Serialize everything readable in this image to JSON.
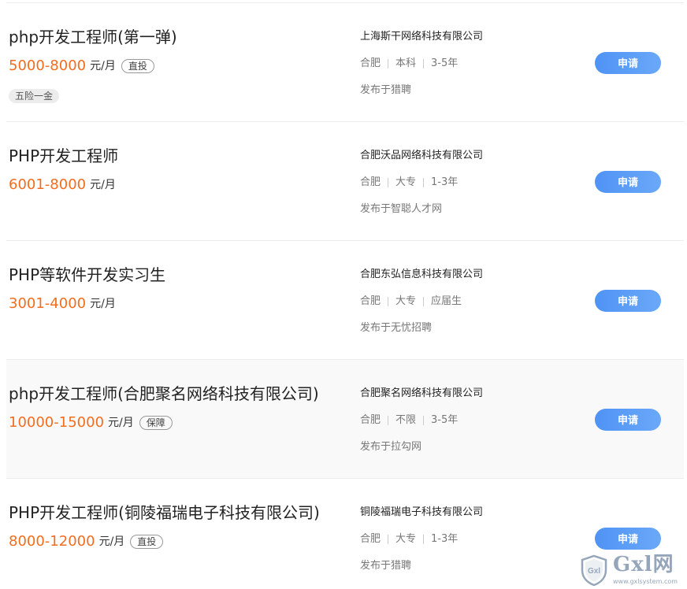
{
  "jobs": [
    {
      "title": "php开发工程师(第一弹)",
      "salary": "5000-8000",
      "salary_unit": "元/月",
      "badge": "直投",
      "welfare": [
        "五险一金"
      ],
      "company": "上海斯干网络科技有限公司",
      "location": "合肥",
      "education": "本科",
      "experience": "3-5年",
      "source": "发布于猎聘",
      "apply_label": "申请",
      "highlight": false
    },
    {
      "title": "PHP开发工程师",
      "salary": "6001-8000",
      "salary_unit": "元/月",
      "badge": "",
      "welfare": [],
      "company": "合肥沃品网络科技有限公司",
      "location": "合肥",
      "education": "大专",
      "experience": "1-3年",
      "source": "发布于智聪人才网",
      "apply_label": "申请",
      "highlight": false
    },
    {
      "title": "PHP等软件开发实习生",
      "salary": "3001-4000",
      "salary_unit": "元/月",
      "badge": "",
      "welfare": [],
      "company": "合肥东弘信息科技有限公司",
      "location": "合肥",
      "education": "大专",
      "experience": "应届生",
      "source": "发布于无忧招聘",
      "apply_label": "申请",
      "highlight": false
    },
    {
      "title": "php开发工程师(合肥聚名网络科技有限公司)",
      "salary": "10000-15000",
      "salary_unit": "元/月",
      "badge": "保障",
      "welfare": [],
      "company": "合肥聚名网络科技有限公司",
      "location": "合肥",
      "education": "不限",
      "experience": "3-5年",
      "source": "发布于拉勾网",
      "apply_label": "申请",
      "highlight": true
    },
    {
      "title": "PHP开发工程师(铜陵福瑞电子科技有限公司)",
      "salary": "8000-12000",
      "salary_unit": "元/月",
      "badge": "直投",
      "welfare": [],
      "company": "铜陵福瑞电子科技有限公司",
      "location": "合肥",
      "education": "大专",
      "experience": "1-3年",
      "source": "发布于猎聘",
      "apply_label": "申请",
      "highlight": false
    }
  ],
  "watermark": {
    "title": "Gxl网",
    "url": "www.gxlsystem.com",
    "shield_text": "Gxl"
  },
  "colors": {
    "salary": "#f26d1f",
    "apply_button": "#5a9cf6",
    "watermark": "#7f93ac"
  }
}
